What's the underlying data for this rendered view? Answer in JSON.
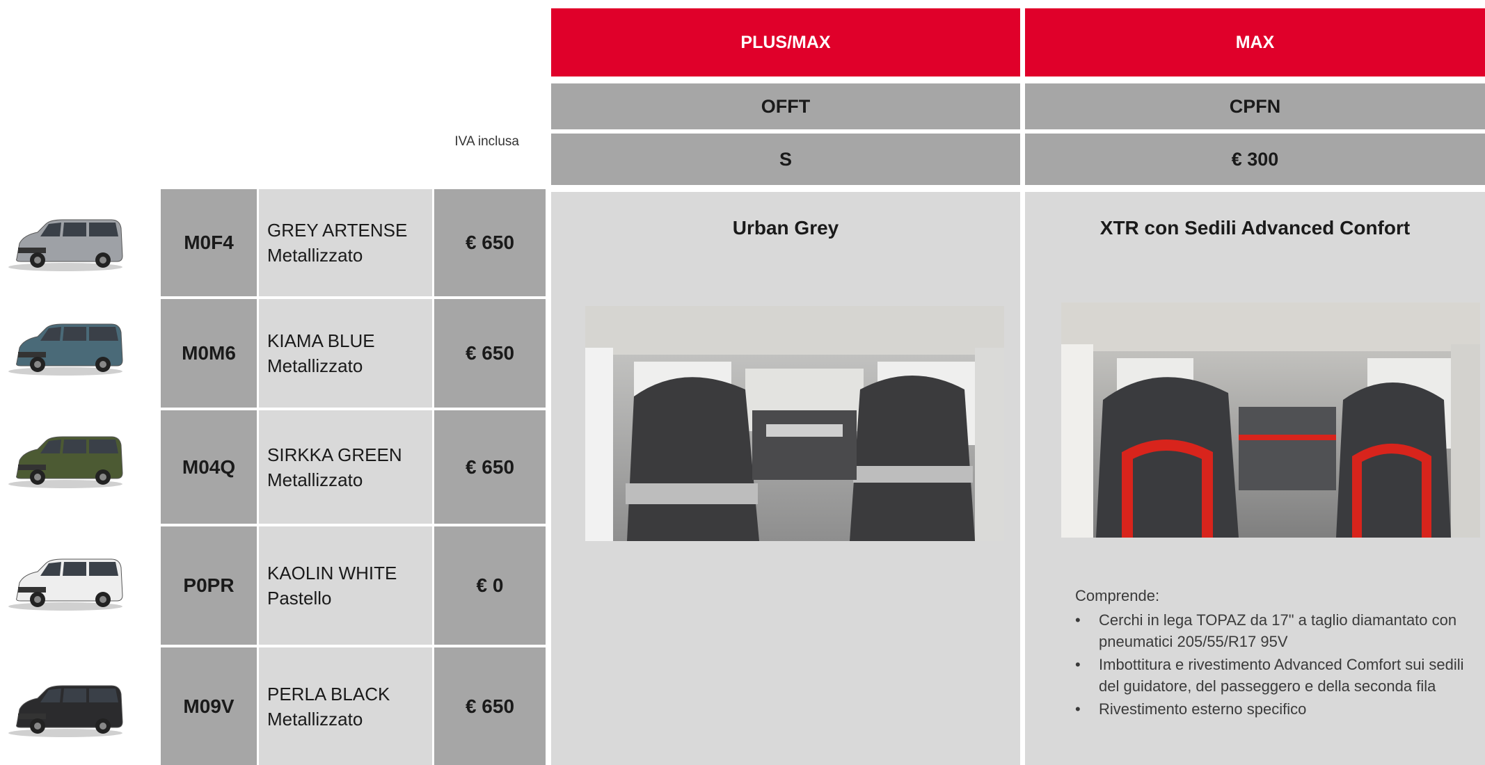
{
  "header": {
    "col1_trim": "PLUS/MAX",
    "col2_trim": "MAX",
    "col1_code": "OFFT",
    "col2_code": "CPFN",
    "col1_price": "S",
    "col2_price": "€ 300",
    "vat_note": "IVA inclusa"
  },
  "colors": [
    {
      "code": "M0F4",
      "name": "GREY ARTENSE",
      "finish": "Metallizzato",
      "price": "€ 650",
      "car_color": "#9ea1a6"
    },
    {
      "code": "M0M6",
      "name": "KIAMA BLUE",
      "finish": "Metallizzato",
      "price": "€ 650",
      "car_color": "#4a6a78"
    },
    {
      "code": "M04Q",
      "name": "SIRKKA GREEN",
      "finish": "Metallizzato",
      "price": "€ 650",
      "car_color": "#4c5a33"
    },
    {
      "code": "P0PR",
      "name": "KAOLIN WHITE",
      "finish": "Pastello",
      "price": "€ 0",
      "car_color": "#eeeeee"
    },
    {
      "code": "M09V",
      "name": "PERLA BLACK",
      "finish": "Metallizzato",
      "price": "€ 650",
      "car_color": "#2b2b2d"
    }
  ],
  "interiors": [
    {
      "title": "Urban Grey",
      "accent": "#b8b8b8"
    },
    {
      "title": "XTR con Sedili Advanced Confort",
      "accent": "#d8241c",
      "includes_label": "Comprende:",
      "features": [
        "Cerchi in lega TOPAZ da 17\" a taglio diamantato con pneumatici 205/55/R17 95V",
        "Imbottitura e rivestimento Advanced Comfort sui sedili del guidatore, del passeggero e della seconda fila",
        "Rivestimento esterno specifico"
      ]
    }
  ],
  "brand_colors": {
    "red": "#e0002a",
    "dark_grey": "#a6a6a6",
    "light_grey": "#d9d9d9"
  }
}
